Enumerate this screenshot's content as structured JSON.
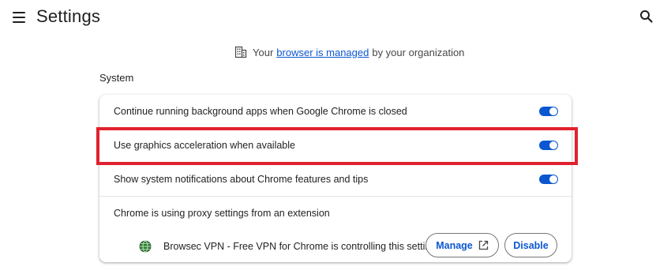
{
  "header": {
    "title": "Settings",
    "menu_icon": "hamburger-menu-icon",
    "search_icon": "search-icon"
  },
  "managed_notice": {
    "icon": "building-icon",
    "prefix": "Your",
    "link": "browser is managed",
    "suffix": "by your organization"
  },
  "section": {
    "title": "System"
  },
  "settings": [
    {
      "label": "Continue running background apps when Google Chrome is closed",
      "enabled": true
    },
    {
      "label": "Use graphics acceleration when available",
      "enabled": true
    },
    {
      "label": "Show system notifications about Chrome features and tips",
      "enabled": true
    }
  ],
  "proxy": {
    "label": "Chrome is using proxy settings from an extension",
    "extension_icon": "globe-icon",
    "extension_text": "Browsec VPN - Free VPN for Chrome is controlling this setting",
    "manage_label": "Manage",
    "manage_icon": "open-in-new-icon",
    "disable_label": "Disable"
  },
  "colors": {
    "accent": "#0b57d0",
    "highlight": "#e0222e"
  }
}
